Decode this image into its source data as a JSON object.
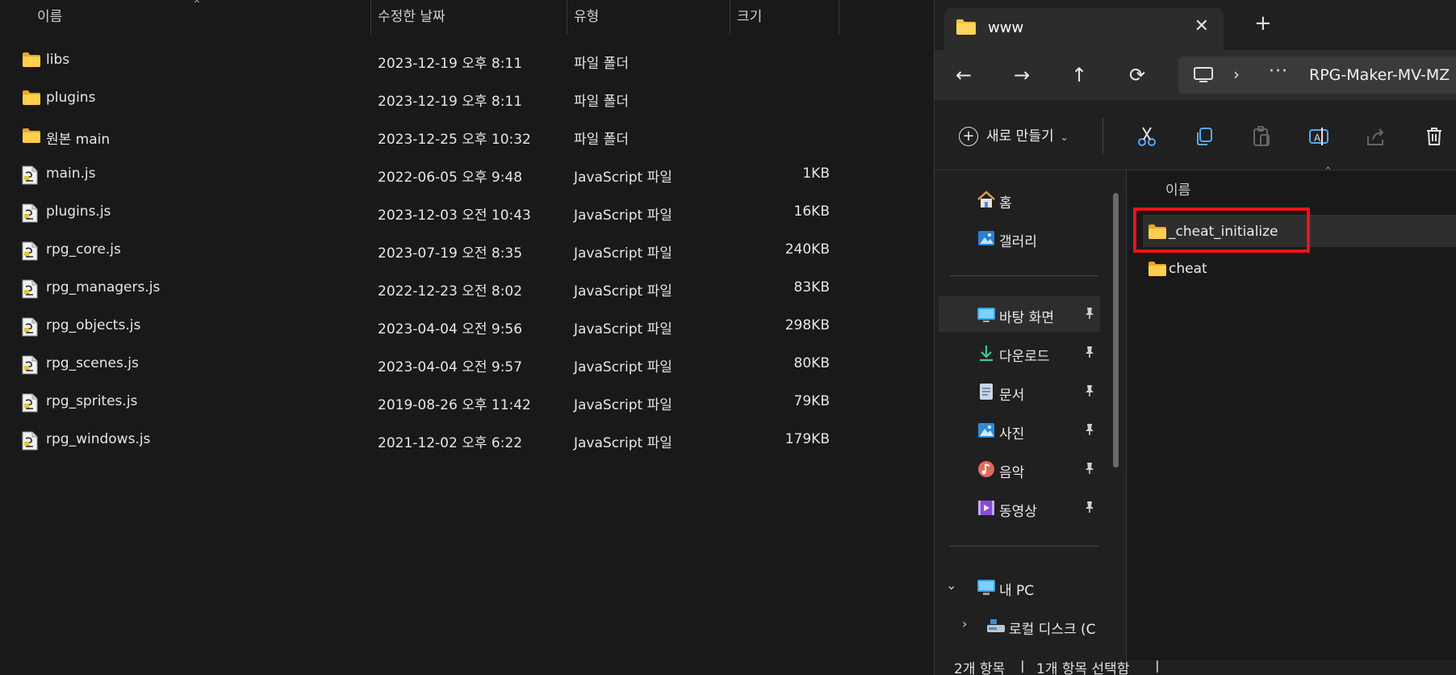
{
  "left_list": {
    "columns": {
      "name": "이름",
      "date": "수정한 날짜",
      "type": "유형",
      "size": "크기"
    },
    "rows": [
      {
        "icon": "folder-icon",
        "name": "libs",
        "date": "2023-12-19 오후 8:11",
        "type": "파일 폴더",
        "size": ""
      },
      {
        "icon": "folder-icon",
        "name": "plugins",
        "date": "2023-12-19 오후 8:11",
        "type": "파일 폴더",
        "size": ""
      },
      {
        "icon": "folder-icon",
        "name": "원본 main",
        "date": "2023-12-25 오후 10:32",
        "type": "파일 폴더",
        "size": ""
      },
      {
        "icon": "js-file-icon",
        "name": "main.js",
        "date": "2022-06-05 오후 9:48",
        "type": "JavaScript 파일",
        "size": "1KB"
      },
      {
        "icon": "js-file-icon",
        "name": "plugins.js",
        "date": "2023-12-03 오전 10:43",
        "type": "JavaScript 파일",
        "size": "16KB"
      },
      {
        "icon": "js-file-icon",
        "name": "rpg_core.js",
        "date": "2023-07-19 오전 8:35",
        "type": "JavaScript 파일",
        "size": "240KB"
      },
      {
        "icon": "js-file-icon",
        "name": "rpg_managers.js",
        "date": "2022-12-23 오전 8:02",
        "type": "JavaScript 파일",
        "size": "83KB"
      },
      {
        "icon": "js-file-icon",
        "name": "rpg_objects.js",
        "date": "2023-04-04 오전 9:56",
        "type": "JavaScript 파일",
        "size": "298KB"
      },
      {
        "icon": "js-file-icon",
        "name": "rpg_scenes.js",
        "date": "2023-04-04 오전 9:57",
        "type": "JavaScript 파일",
        "size": "80KB"
      },
      {
        "icon": "js-file-icon",
        "name": "rpg_sprites.js",
        "date": "2019-08-26 오후 11:42",
        "type": "JavaScript 파일",
        "size": "79KB"
      },
      {
        "icon": "js-file-icon",
        "name": "rpg_windows.js",
        "date": "2021-12-02 오후 6:22",
        "type": "JavaScript 파일",
        "size": "179KB"
      }
    ]
  },
  "explorer": {
    "tab_title": "www",
    "address": {
      "crumb": "RPG-Maker-MV-MZ",
      "chevron": "›",
      "overflow": "···"
    },
    "new_button_label": "새로 만들기",
    "nav_items": [
      {
        "label": "홈",
        "icon": "home-icon",
        "pinned": false
      },
      {
        "label": "갤러리",
        "icon": "gallery-icon",
        "pinned": false
      },
      {
        "label": "바탕 화면",
        "icon": "desktop-icon",
        "pinned": true
      },
      {
        "label": "다운로드",
        "icon": "download-icon",
        "pinned": true
      },
      {
        "label": "문서",
        "icon": "document-icon",
        "pinned": true
      },
      {
        "label": "사진",
        "icon": "pictures-icon",
        "pinned": true
      },
      {
        "label": "음악",
        "icon": "music-icon",
        "pinned": true
      },
      {
        "label": "동영상",
        "icon": "video-icon",
        "pinned": true
      },
      {
        "label": "내 PC",
        "icon": "pc-icon",
        "pinned": false
      },
      {
        "label": "로컬 디스크 (C",
        "icon": "drive-icon",
        "pinned": false
      }
    ],
    "content_header": "이름",
    "items": [
      {
        "label": "_cheat_initialize",
        "selected": true
      },
      {
        "label": "cheat",
        "selected": false
      }
    ],
    "status": {
      "count": "2개 항목",
      "selected": "1개 항목 선택함"
    }
  },
  "colors": {
    "highlight": "#e8131b",
    "folder": "#f5c342",
    "background": "#191919"
  }
}
